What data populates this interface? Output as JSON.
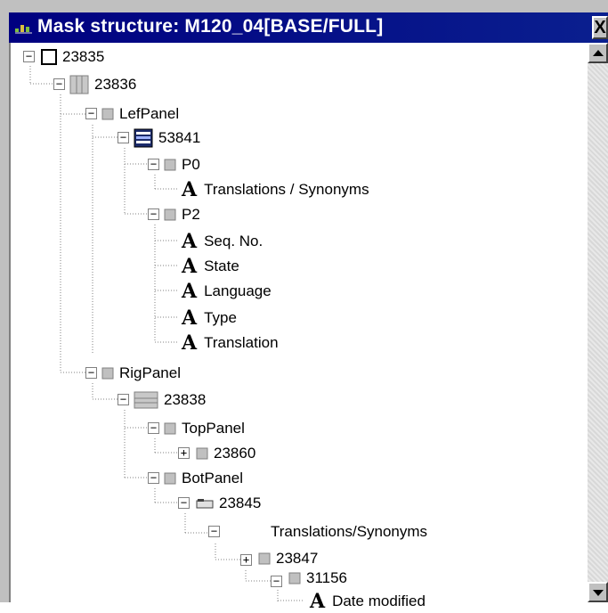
{
  "window": {
    "title": "Mask structure: M120_04[BASE/FULL]",
    "close_glyph": "X"
  },
  "tree": {
    "n1": {
      "label": "23835",
      "icon": "square-icon"
    },
    "n2": {
      "label": "23836",
      "icon": "grid-panel-icon"
    },
    "n3": {
      "label": "LefPanel",
      "icon": "panel-icon"
    },
    "n4": {
      "label": "53841",
      "icon": "form-icon"
    },
    "n5": {
      "label": "P0",
      "icon": "panel-icon"
    },
    "n6": {
      "label": "Translations / Synonyms",
      "icon": "text-field-icon"
    },
    "n7": {
      "label": "P2",
      "icon": "panel-icon"
    },
    "n8": {
      "label": "Seq. No.",
      "icon": "text-field-icon"
    },
    "n9": {
      "label": "State",
      "icon": "text-field-icon"
    },
    "n10": {
      "label": "Language",
      "icon": "text-field-icon"
    },
    "n11": {
      "label": "Type",
      "icon": "text-field-icon"
    },
    "n12": {
      "label": "Translation",
      "icon": "text-field-icon"
    },
    "n13": {
      "label": "RigPanel",
      "icon": "panel-icon"
    },
    "n14": {
      "label": "23838",
      "icon": "grid-panel-icon"
    },
    "n15": {
      "label": "TopPanel",
      "icon": "panel-icon"
    },
    "n16": {
      "label": "23860",
      "icon": "panel-icon"
    },
    "n17": {
      "label": "BotPanel",
      "icon": "panel-icon"
    },
    "n18": {
      "label": "23845",
      "icon": "tab-icon"
    },
    "n19": {
      "label": "Translations/Synonyms",
      "icon": "blank-icon"
    },
    "n20": {
      "label": "23847",
      "icon": "panel-icon"
    },
    "n21": {
      "label": "31156",
      "icon": "panel-icon"
    },
    "n22": {
      "label": "Date modified",
      "icon": "text-field-icon"
    }
  },
  "colors": {
    "titlebar": "#000080",
    "window_bg": "#c0c0c0",
    "tree_bg": "#ffffff"
  }
}
